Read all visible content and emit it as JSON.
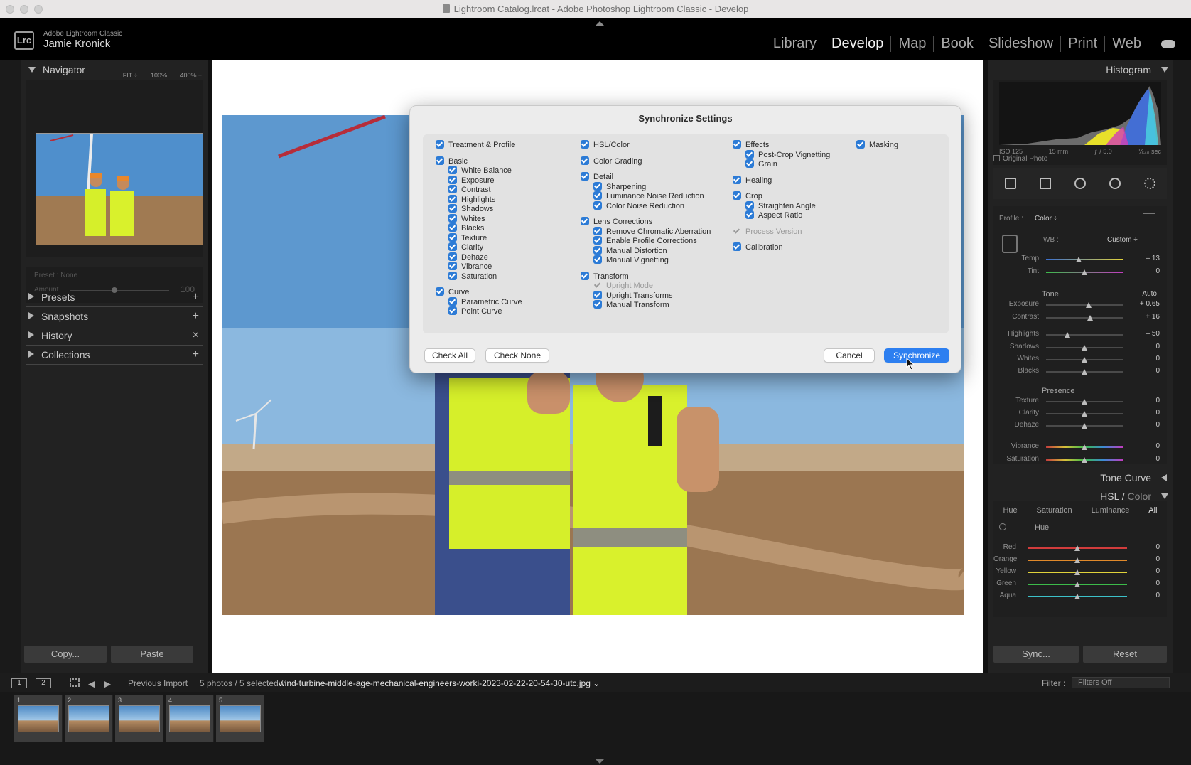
{
  "window": {
    "title": "Lightroom Catalog.lrcat - Adobe Photoshop Lightroom Classic - Develop"
  },
  "identity": {
    "badge": "Lrc",
    "brand": "Adobe Lightroom Classic",
    "user": "Jamie Kronick"
  },
  "modules": [
    "Library",
    "Develop",
    "Map",
    "Book",
    "Slideshow",
    "Print",
    "Web"
  ],
  "active_module": "Develop",
  "left_panel": {
    "navigator": {
      "title": "Navigator",
      "zoom": [
        "FIT ÷",
        "100%",
        "400% ÷"
      ]
    },
    "preset": {
      "label": "Preset : None",
      "amount_label": "Amount",
      "amount_value": "100",
      "amount_fraction": 0.45
    },
    "sections": [
      {
        "name": "Presets",
        "action": "+"
      },
      {
        "name": "Snapshots",
        "action": "+"
      },
      {
        "name": "History",
        "action": "×"
      },
      {
        "name": "Collections",
        "action": "+"
      }
    ],
    "copy_label": "Copy...",
    "paste_label": "Paste"
  },
  "dialog": {
    "title": "Synchronize Settings",
    "col1": [
      {
        "label": "Treatment & Profile",
        "level": 0,
        "checked": true
      },
      {
        "label": "Basic",
        "level": 0,
        "checked": true
      },
      {
        "label": "White Balance",
        "level": 1,
        "checked": true
      },
      {
        "label": "Exposure",
        "level": 1,
        "checked": true
      },
      {
        "label": "Contrast",
        "level": 1,
        "checked": true
      },
      {
        "label": "Highlights",
        "level": 1,
        "checked": true
      },
      {
        "label": "Shadows",
        "level": 1,
        "checked": true
      },
      {
        "label": "Whites",
        "level": 1,
        "checked": true
      },
      {
        "label": "Blacks",
        "level": 1,
        "checked": true
      },
      {
        "label": "Texture",
        "level": 1,
        "checked": true
      },
      {
        "label": "Clarity",
        "level": 1,
        "checked": true
      },
      {
        "label": "Dehaze",
        "level": 1,
        "checked": true
      },
      {
        "label": "Vibrance",
        "level": 1,
        "checked": true
      },
      {
        "label": "Saturation",
        "level": 1,
        "checked": true
      },
      {
        "label": "Curve",
        "level": 0,
        "checked": true
      },
      {
        "label": "Parametric Curve",
        "level": 1,
        "checked": true
      },
      {
        "label": "Point Curve",
        "level": 1,
        "checked": true
      }
    ],
    "col2": [
      {
        "label": "HSL/Color",
        "level": 0,
        "checked": true
      },
      {
        "label": "Color Grading",
        "level": 0,
        "checked": true
      },
      {
        "label": "Detail",
        "level": 0,
        "checked": true
      },
      {
        "label": "Sharpening",
        "level": 1,
        "checked": true
      },
      {
        "label": "Luminance Noise Reduction",
        "level": 1,
        "checked": true
      },
      {
        "label": "Color Noise Reduction",
        "level": 1,
        "checked": true
      },
      {
        "label": "Lens Corrections",
        "level": 0,
        "checked": true
      },
      {
        "label": "Remove Chromatic Aberration",
        "level": 1,
        "checked": true
      },
      {
        "label": "Enable Profile Corrections",
        "level": 1,
        "checked": true
      },
      {
        "label": "Manual Distortion",
        "level": 1,
        "checked": true
      },
      {
        "label": "Manual Vignetting",
        "level": 1,
        "checked": true
      },
      {
        "label": "Transform",
        "level": 0,
        "checked": true
      },
      {
        "label": "Upright Mode",
        "level": 1,
        "checked": true,
        "disabled": true
      },
      {
        "label": "Upright Transforms",
        "level": 1,
        "checked": true
      },
      {
        "label": "Manual Transform",
        "level": 1,
        "checked": true
      }
    ],
    "col3": [
      {
        "label": "Effects",
        "level": 0,
        "checked": true
      },
      {
        "label": "Post-Crop Vignetting",
        "level": 1,
        "checked": true
      },
      {
        "label": "Grain",
        "level": 1,
        "checked": true
      },
      {
        "label": "Healing",
        "level": 0,
        "checked": true
      },
      {
        "label": "Crop",
        "level": 0,
        "checked": true
      },
      {
        "label": "Straighten Angle",
        "level": 1,
        "checked": true
      },
      {
        "label": "Aspect Ratio",
        "level": 1,
        "checked": true
      },
      {
        "label": "Process Version",
        "level": 0,
        "checked": true,
        "disabled": true
      },
      {
        "label": "Calibration",
        "level": 0,
        "checked": true
      }
    ],
    "col4": [
      {
        "label": "Masking",
        "level": 0,
        "checked": true
      }
    ],
    "check_all": "Check All",
    "check_none": "Check None",
    "cancel": "Cancel",
    "synchronize": "Synchronize"
  },
  "right_panel": {
    "histogram": {
      "title": "Histogram",
      "iso": "ISO 125",
      "focal": "15 mm",
      "aperture": "ƒ / 5.0",
      "shutter": "⅟₆₄₀ sec",
      "original": "Original Photo"
    },
    "profile": {
      "label": "Profile :",
      "value": "Color ÷"
    },
    "wb": {
      "label": "WB :",
      "value": "Custom ÷"
    },
    "tone_label": "Tone",
    "auto_label": "Auto",
    "presence_label": "Presence",
    "sliders": [
      {
        "name": "Temp",
        "value": "– 13",
        "pos": 0.43
      },
      {
        "name": "Tint",
        "value": "0",
        "pos": 0.5
      },
      {
        "name": "Exposure",
        "value": "+ 0.65",
        "pos": 0.56
      },
      {
        "name": "Contrast",
        "value": "+ 16",
        "pos": 0.57
      },
      {
        "name": "Highlights",
        "value": "– 50",
        "pos": 0.28
      },
      {
        "name": "Shadows",
        "value": "0",
        "pos": 0.5
      },
      {
        "name": "Whites",
        "value": "0",
        "pos": 0.5
      },
      {
        "name": "Blacks",
        "value": "0",
        "pos": 0.5
      },
      {
        "name": "Texture",
        "value": "0",
        "pos": 0.5
      },
      {
        "name": "Clarity",
        "value": "0",
        "pos": 0.5
      },
      {
        "name": "Dehaze",
        "value": "0",
        "pos": 0.5
      },
      {
        "name": "Vibrance",
        "value": "0",
        "pos": 0.5
      },
      {
        "name": "Saturation",
        "value": "0",
        "pos": 0.5
      }
    ],
    "tone_curve": "Tone Curve",
    "hsl_title": "HSL",
    "hsl_color": "Color",
    "hsl_tabs": [
      "Hue",
      "Saturation",
      "Luminance",
      "All"
    ],
    "hue_label": "Hue",
    "hue_sliders": [
      {
        "name": "Red",
        "value": "0",
        "pos": 0.5
      },
      {
        "name": "Orange",
        "value": "0",
        "pos": 0.5
      },
      {
        "name": "Yellow",
        "value": "0",
        "pos": 0.5
      },
      {
        "name": "Green",
        "value": "0",
        "pos": 0.5
      },
      {
        "name": "Aqua",
        "value": "0",
        "pos": 0.5
      }
    ],
    "sync_label": "Sync...",
    "reset_label": "Reset"
  },
  "filmstrip": {
    "screens": [
      "1",
      "2"
    ],
    "source": "Previous Import",
    "count": "5 photos / 5 selected /",
    "filename": "wind-turbine-middle-age-mechanical-engineers-worki-2023-02-22-20-54-30-utc.jpg",
    "filter_label": "Filter :",
    "filter_value": "Filters Off",
    "frames": [
      "1",
      "2",
      "3",
      "4",
      "5"
    ]
  },
  "colors": {
    "accent": "#2d7ff0",
    "panel": "#222222",
    "dialog": "#ececec"
  }
}
